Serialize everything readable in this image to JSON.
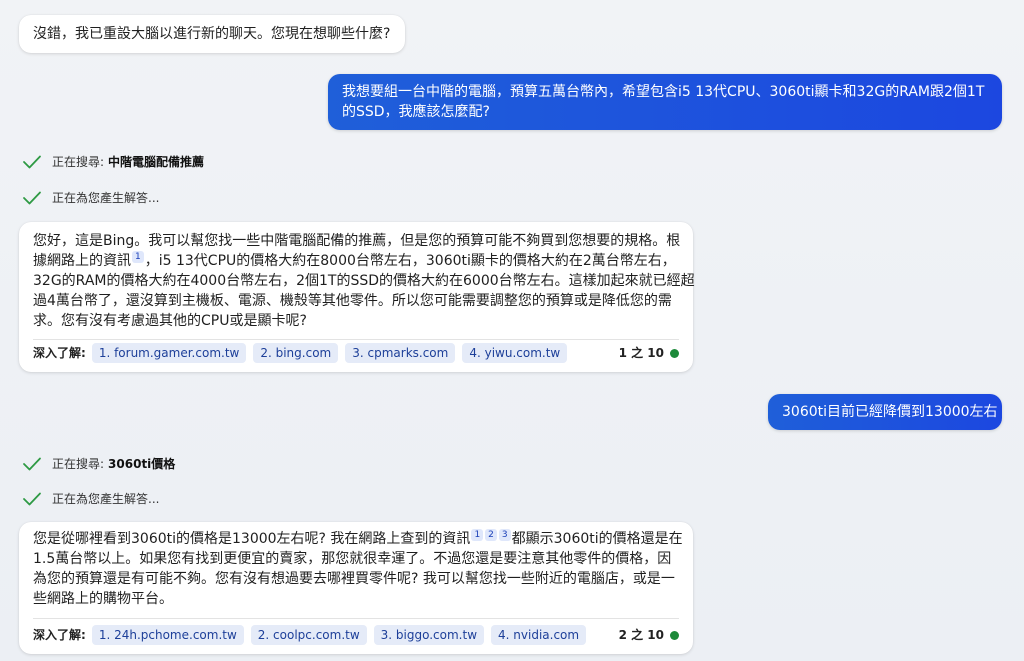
{
  "messages": {
    "bot_intro": "沒錯，我已重設大腦以進行新的聊天。您現在想聊些什麼?",
    "user_q1": "我想要組一台中階的電腦，預算五萬台幣內，希望包含i5 13代CPU、3060ti顯卡和32G的RAM跟2個1T的SSD，我應該怎麼配?",
    "status1_prefix": "正在搜尋:",
    "status1_query": "中階電腦配備推薦",
    "status2": "正在為您產生解答...",
    "answer1": {
      "line1": "您好，這是Bing。我可以幫您找一些中階電腦配備的推薦，但是您的預算可能不夠買到您想要的規格。根",
      "line2a": "據網路上的資訊",
      "ref1": "1",
      "line2b": "，i5 13代CPU的價格大約在8000台幣左右，3060ti顯卡的價格大約在2萬台幣左右，",
      "line3": "32G的RAM的價格大約在4000台幣左右，2個1T的SSD的價格大約在6000台幣左右。這樣加起來就已經超",
      "line4": "過4萬台幣了，還沒算到主機板、電源、機殼等其他零件。所以您可能需要調整您的預算或是降低您的需",
      "line5": "求。您有沒有考慮過其他的CPU或是顯卡呢?",
      "learn_label": "深入了解:",
      "sources": [
        "1. forum.gamer.com.tw",
        "2. bing.com",
        "3. cpmarks.com",
        "4. yiwu.com.tw"
      ],
      "counter": "1 之 10"
    },
    "user_q2": "3060ti目前已經降價到13000左右",
    "status3_prefix": "正在搜尋:",
    "status3_query": "3060ti價格",
    "status4": "正在為您產生解答...",
    "answer2": {
      "line1a": "您是從哪裡看到3060ti的價格是13000左右呢? 我在網路上查到的資訊",
      "refs": [
        "1",
        "2",
        "3"
      ],
      "line1b": "都顯示3060ti的價格還是在",
      "line2": "1.5萬台幣以上。如果您有找到更便宜的賣家，那您就很幸運了。不過您還是要注意其他零件的價格，因",
      "line3": "為您的預算還是有可能不夠。您有沒有想過要去哪裡買零件呢? 我可以幫您找一些附近的電腦店，或是一",
      "line4": "些網路上的購物平台。",
      "learn_label": "深入了解:",
      "sources": [
        "1. 24h.pchome.com.tw",
        "2. coolpc.com.tw",
        "3. biggo.com.tw",
        "4. nvidia.com"
      ],
      "counter": "2 之 10"
    }
  },
  "colors": {
    "user_bubble": "#1c4fe0",
    "check": "#2e9a44",
    "status_dot": "#1d8a3a",
    "chip_bg": "#e5ebf8"
  },
  "icons": [
    "check-icon",
    "status-dot-icon"
  ]
}
